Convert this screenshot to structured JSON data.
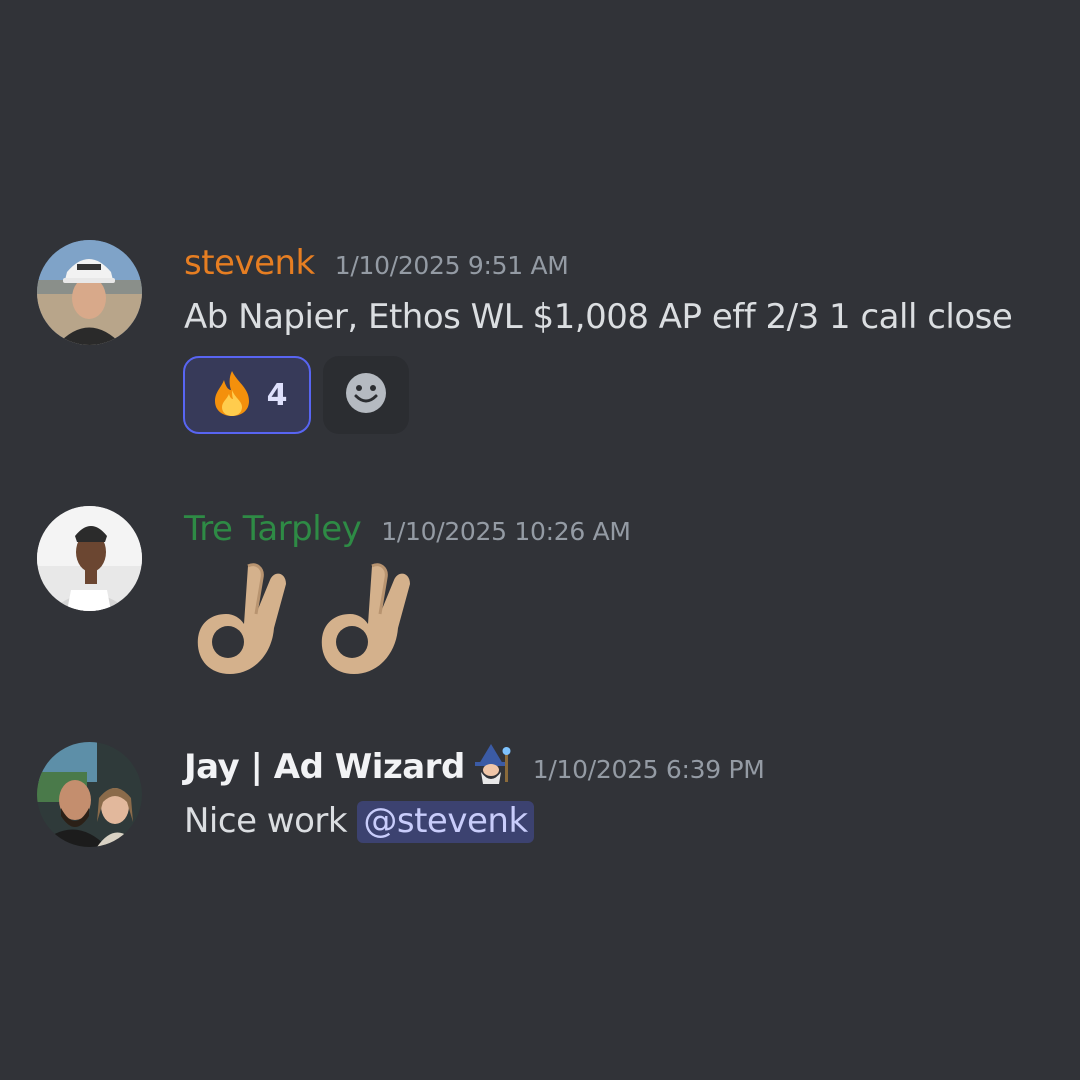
{
  "messages": [
    {
      "username": "stevenk",
      "username_color": "#e67e22",
      "timestamp": "1/10/2025 9:51 AM",
      "text": "Ab Napier, Ethos WL $1,008 AP eff 2/3 1 call close",
      "reactions": [
        {
          "emoji": "fire-emoji",
          "count": "4",
          "active": true
        }
      ],
      "add_reaction_icon": "smiley-icon"
    },
    {
      "username": "Tre Tarpley",
      "username_color": "#2e8b45",
      "timestamp": "1/10/2025 10:26 AM",
      "emojis": [
        "ok-hand-emoji",
        "ok-hand-emoji"
      ]
    },
    {
      "username": "Jay | Ad Wizard",
      "username_badge": "mage-emoji",
      "username_color": "#f2f3f5",
      "timestamp": "1/10/2025 6:39 PM",
      "text": "Nice work ",
      "mention": "@stevenk"
    }
  ]
}
